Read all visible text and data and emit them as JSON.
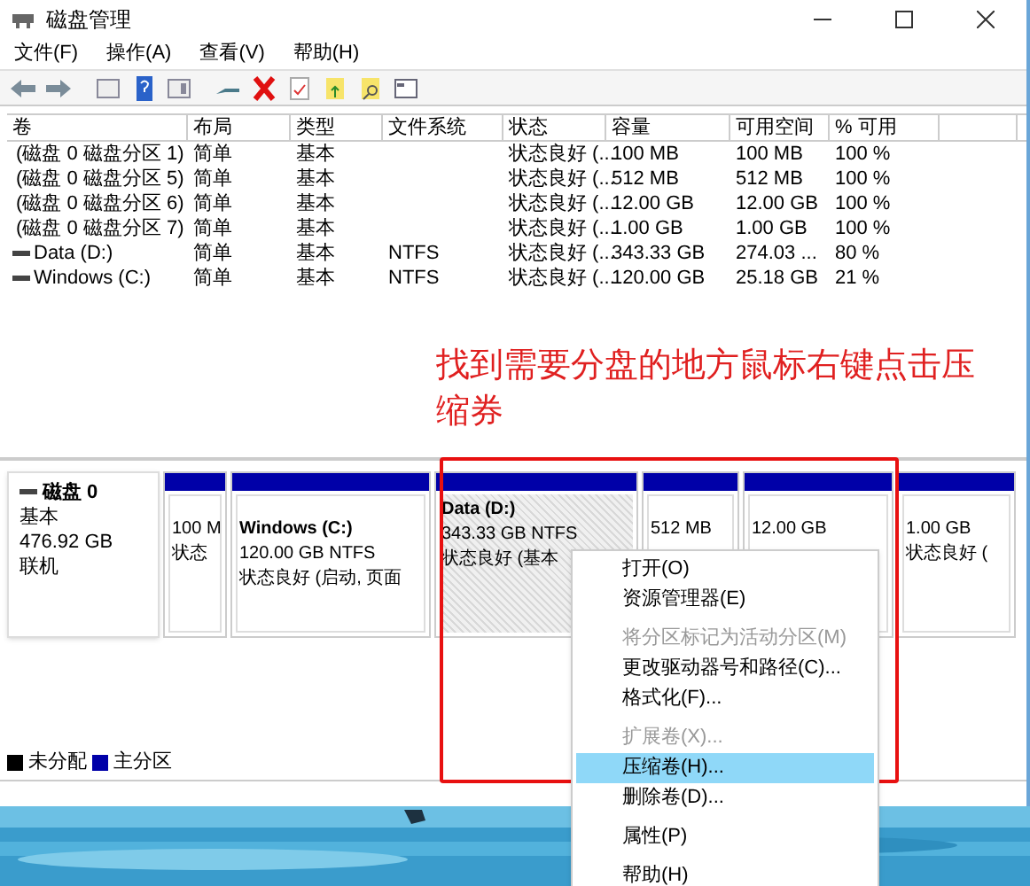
{
  "window": {
    "title": "磁盘管理"
  },
  "menu": [
    "文件(F)",
    "操作(A)",
    "查看(V)",
    "帮助(H)"
  ],
  "table": {
    "columns": [
      "卷",
      "布局",
      "类型",
      "文件系统",
      "状态",
      "容量",
      "可用空间",
      "% 可用"
    ],
    "rows": [
      [
        "(磁盘 0 磁盘分区 1)",
        "简单",
        "基本",
        "",
        "状态良好 (...",
        "100 MB",
        "100 MB",
        "100 %"
      ],
      [
        "(磁盘 0 磁盘分区 5)",
        "简单",
        "基本",
        "",
        "状态良好 (...",
        "512 MB",
        "512 MB",
        "100 %"
      ],
      [
        "(磁盘 0 磁盘分区 6)",
        "简单",
        "基本",
        "",
        "状态良好 (...",
        "12.00 GB",
        "12.00 GB",
        "100 %"
      ],
      [
        "(磁盘 0 磁盘分区 7)",
        "简单",
        "基本",
        "",
        "状态良好 (...",
        "1.00 GB",
        "1.00 GB",
        "100 %"
      ],
      [
        "Data (D:)",
        "简单",
        "基本",
        "NTFS",
        "状态良好 (...",
        "343.33 GB",
        "274.03 ...",
        "80 %"
      ],
      [
        "Windows (C:)",
        "简单",
        "基本",
        "NTFS",
        "状态良好 (...",
        "120.00 GB",
        "25.18 GB",
        "21 %"
      ]
    ]
  },
  "annotation": "找到需要分盘的地方鼠标右键点击压缩券",
  "disk": {
    "name": "磁盘 0",
    "type": "基本",
    "size": "476.92 GB",
    "status": "联机",
    "partitions": [
      {
        "lines": [
          "100 M",
          "状态"
        ],
        "selected": false
      },
      {
        "title": "Windows  (C:)",
        "lines": [
          "120.00 GB NTFS",
          "状态良好 (启动, 页面"
        ],
        "selected": false
      },
      {
        "title": "Data  (D:)",
        "lines": [
          "343.33 GB NTFS",
          "状态良好 (基本"
        ],
        "selected": true
      },
      {
        "lines": [
          "512 MB"
        ],
        "selected": false
      },
      {
        "lines": [
          "12.00 GB"
        ],
        "selected": false
      },
      {
        "lines": [
          "1.00 GB",
          "状态良好 ("
        ],
        "selected": false
      }
    ]
  },
  "legend": [
    {
      "label": "未分配",
      "color": "#000000"
    },
    {
      "label": "主分区",
      "color": "#0000a8"
    }
  ],
  "context_menu": [
    {
      "kind": "item",
      "label": "打开(O)",
      "disabled": false,
      "selected": false
    },
    {
      "kind": "item",
      "label": "资源管理器(E)",
      "disabled": false,
      "selected": false
    },
    {
      "kind": "separator"
    },
    {
      "kind": "item",
      "label": "将分区标记为活动分区(M)",
      "disabled": true,
      "selected": false
    },
    {
      "kind": "item",
      "label": "更改驱动器号和路径(C)...",
      "disabled": false,
      "selected": false
    },
    {
      "kind": "item",
      "label": "格式化(F)...",
      "disabled": false,
      "selected": false
    },
    {
      "kind": "separator"
    },
    {
      "kind": "item",
      "label": "扩展卷(X)...",
      "disabled": true,
      "selected": false
    },
    {
      "kind": "item",
      "label": "压缩卷(H)...",
      "disabled": false,
      "selected": true
    },
    {
      "kind": "item",
      "label": "删除卷(D)...",
      "disabled": false,
      "selected": false
    },
    {
      "kind": "separator"
    },
    {
      "kind": "item",
      "label": "属性(P)",
      "disabled": false,
      "selected": false
    },
    {
      "kind": "separator"
    },
    {
      "kind": "item",
      "label": "帮助(H)",
      "disabled": false,
      "selected": false
    }
  ]
}
